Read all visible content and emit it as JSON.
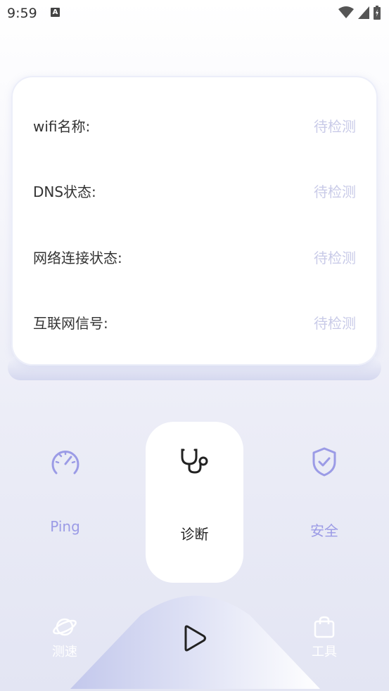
{
  "status_bar": {
    "time": "9:59",
    "badge": "A"
  },
  "card": {
    "rows": [
      {
        "label": "wifi名称:",
        "value": "待检测"
      },
      {
        "label": "DNS状态:",
        "value": "待检测"
      },
      {
        "label": "网络连接状态:",
        "value": "待检测"
      },
      {
        "label": "互联网信号:",
        "value": "待检测"
      }
    ]
  },
  "features": {
    "ping": "Ping",
    "diagnose": "诊断",
    "security": "安全"
  },
  "bottom_nav": {
    "speed": "测速",
    "tools": "工具"
  },
  "colors": {
    "accent": "#9b9be6",
    "pending": "#c9cbe8",
    "text": "#333333"
  }
}
